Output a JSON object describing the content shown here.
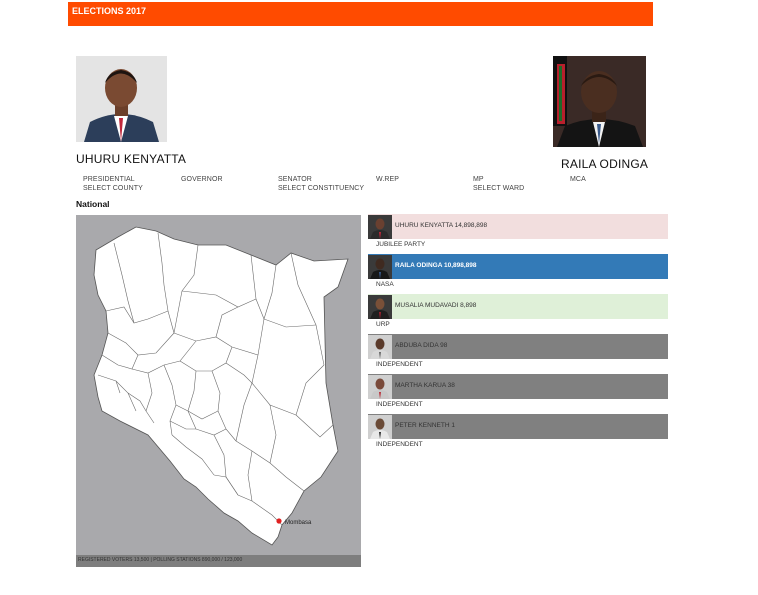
{
  "header": {
    "title": "ELECTIONS 2017",
    "color": "#ff4b00"
  },
  "candidates_top": {
    "left": {
      "name": "UHURU KENYATTA"
    },
    "right": {
      "name": "RAILA ODINGA"
    }
  },
  "nav": {
    "presidential": "PRESIDENTIAL",
    "governor": "GOVERNOR",
    "senator": "SENATOR",
    "wrep": "W.REP",
    "mp": "MP",
    "mca": "MCA",
    "select_county": "SELECT COUNTY",
    "select_constituency": "SELECT CONSTITUENCY",
    "select_ward": "SELECT WARD"
  },
  "section": {
    "label": "National"
  },
  "map": {
    "city_label": "Mombasa",
    "footer": "REGISTERED VOTERS 13,500 | POLLING STATIONS  890,000 / 123,000",
    "background": "#a9a9ac"
  },
  "results": [
    {
      "label": "UHURU KENYATTA 14,898,898",
      "party": "JUBILEE PARTY",
      "bg": "#f2dede",
      "active": false
    },
    {
      "label": "RAILA ODINGA 10,898,898",
      "party": "NASA",
      "bg": "#337ab7",
      "active": true
    },
    {
      "label": "MUSALIA MUDAVADI 8,898",
      "party": "URP",
      "bg": "#dff0d8",
      "active": false
    },
    {
      "label": "ABDUBA DIDA 98",
      "party": "INDEPENDENT",
      "bg": "#808080",
      "active": false
    },
    {
      "label": "MARTHA KARUA 38",
      "party": "INDEPENDENT",
      "bg": "#808080",
      "active": false
    },
    {
      "label": "PETER KENNETH 1",
      "party": "INDEPENDENT",
      "bg": "#808080",
      "active": false
    }
  ]
}
